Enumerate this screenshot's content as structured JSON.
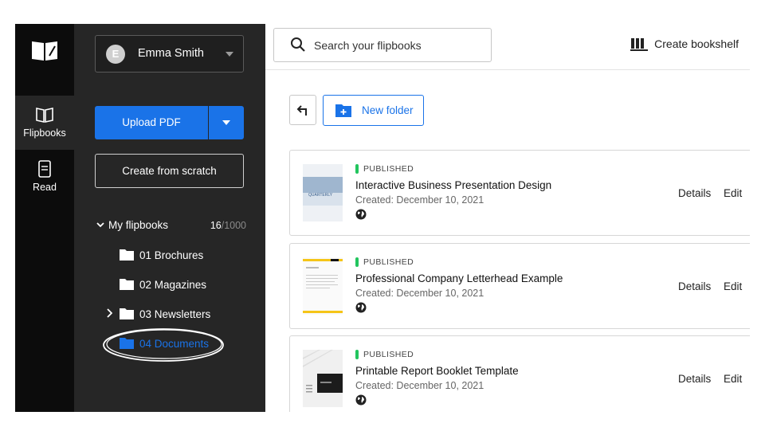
{
  "rail": {
    "items": [
      {
        "label": "Flipbooks",
        "icon": "open-book-icon"
      },
      {
        "label": "Read",
        "icon": "document-icon"
      }
    ]
  },
  "user": {
    "initial": "E",
    "name": "Emma Smith"
  },
  "actions": {
    "upload_label": "Upload PDF",
    "scratch_label": "Create from scratch"
  },
  "tree": {
    "title": "My flipbooks",
    "count_used": "16",
    "count_total": "/1000",
    "folders": [
      "01 Brochures",
      "02 Magazines",
      "03 Newsletters",
      "04 Documents"
    ],
    "active_folder": "04 Documents"
  },
  "topbar": {
    "search_placeholder": "Search your flipbooks",
    "bookshelf_label": "Create bookshelf"
  },
  "toolbar": {
    "new_folder_label": "New folder"
  },
  "flipbooks": [
    {
      "status": "PUBLISHED",
      "title": "Interactive Business Presentation Design",
      "created": "Created: December 10, 2021",
      "details": "Details",
      "edit": "Edit"
    },
    {
      "status": "PUBLISHED",
      "title": "Professional Company Letterhead Example",
      "created": "Created: December 10, 2021",
      "details": "Details",
      "edit": "Edit"
    },
    {
      "status": "PUBLISHED",
      "title": "Printable Report Booklet Template",
      "created": "Created: December 10, 2021",
      "details": "Details",
      "edit": "Edit"
    }
  ],
  "thumb_texts": {
    "card0": "QUARTERLY"
  },
  "colors": {
    "accent": "#1a73e8",
    "published": "#22c55e",
    "rail": "#0c0c0c",
    "sidebar": "#262626",
    "highlight": "#f5c518"
  }
}
